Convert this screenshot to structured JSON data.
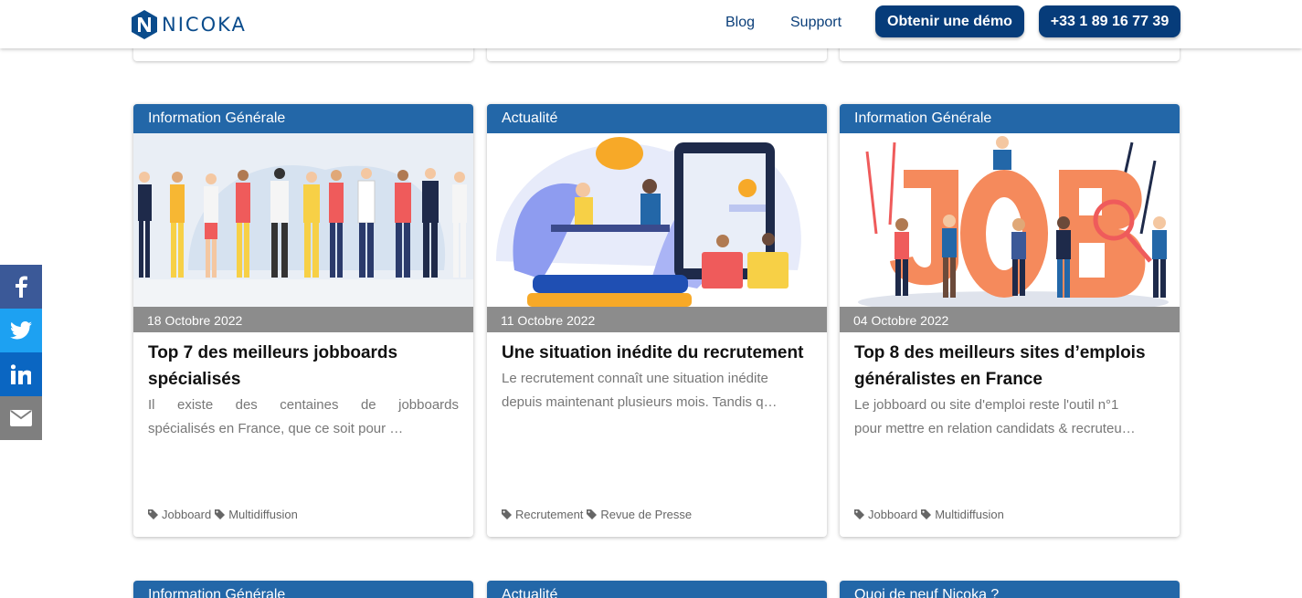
{
  "header": {
    "logo_text": "NICOKA",
    "nav": {
      "blog": "Blog",
      "support": "Support"
    },
    "demo_button": "Obtenir une démo",
    "phone_button": "+33 1 89 16 77 39"
  },
  "social": [
    "facebook",
    "twitter",
    "linkedin",
    "email"
  ],
  "cards": [
    {
      "category": "Information Générale",
      "date": "18 Octobre 2022",
      "title": "Top 7 des meilleurs jobboards spécialisés",
      "excerpt_line1": "Il existe des centaines de jobboards",
      "excerpt_line2": "spécialisés en France, que ce soit pour …",
      "tags": [
        "Jobboard",
        "Multidiffusion"
      ]
    },
    {
      "category": "Actualité",
      "date": "11 Octobre 2022",
      "title": "Une situation inédite du recrutement",
      "excerpt_line1": "Le recrutement connaît une situation inédite",
      "excerpt_line2": "depuis maintenant plusieurs mois. Tandis q…",
      "tags": [
        "Recrutement",
        "Revue de Presse"
      ]
    },
    {
      "category": "Information Générale",
      "date": "04 Octobre 2022",
      "title": "Top 8 des meilleurs sites d’emplois généralistes en France",
      "excerpt_line1": "Le jobboard ou site d'emploi reste l'outil n°1",
      "excerpt_line2": "pour mettre en relation candidats & recruteu…",
      "tags": [
        "Jobboard",
        "Multidiffusion"
      ]
    }
  ],
  "bottom_cards": [
    "Information Générale",
    "Actualité",
    "Quoi de neuf Nicoka ?"
  ],
  "colors": {
    "brand": "#063c7a",
    "category_bar": "#2367a8"
  }
}
